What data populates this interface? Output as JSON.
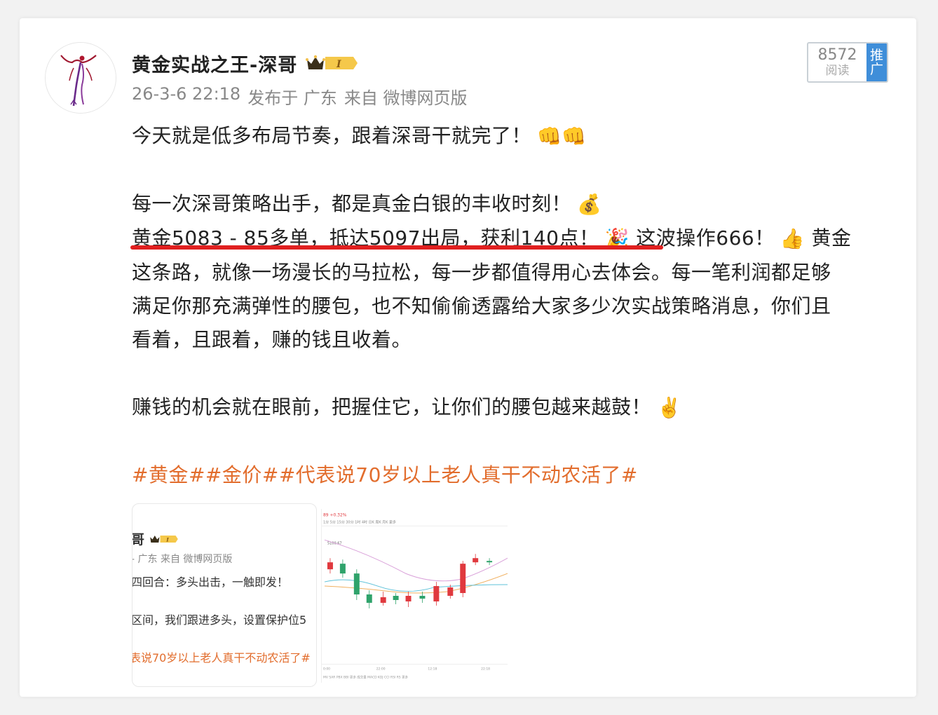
{
  "author": {
    "name": "黄金实战之王-深哥",
    "badge_level": "I"
  },
  "meta": {
    "time": "26-3-6 22:18",
    "location": "发布于 广东",
    "source": "来自 微博网页版"
  },
  "reads": {
    "count": "8572",
    "label": "阅读",
    "promo_label_1": "推",
    "promo_label_2": "广"
  },
  "post": {
    "line1": "今天就是低多布局节奏，跟着深哥干就完了！",
    "line1_emoji": "👊👊",
    "line2": "每一次深哥策略出手，都是真金白银的丰收时刻！",
    "line2_emoji": "💰",
    "line3a": "黄金5083 - 85多单，抵达5097出局，获利140点！",
    "line3_emoji1": "🎉",
    "line3b": "这波操作666！",
    "line3_emoji2": "👍",
    "line3c": "黄金",
    "line4": "这条路，就像一场漫长的马拉松，每一步都值得用心去体会。每一笔利润都足够",
    "line5": "满足你那充满弹性的腰包，也不知偷偷透露给大家多少次实战策略消息，你们且",
    "line6": "看着，且跟着，赚的钱且收着。",
    "line7": "赚钱的机会就在眼前，把握住它，让你们的腰包越来越鼓！",
    "line7_emoji": "✌️",
    "hashtags": "#黄金##金价##代表说70岁以上老人真干不动农活了#"
  },
  "thumbnail_1": {
    "name_fragment": "哥",
    "badge_level": "I",
    "meta_fragment": "- 广东  来自  微博网页版",
    "text1": "四回合：多头出击，一触即发！",
    "text2": "区间，我们跟进多头，设置保护位5",
    "hashtag_fragment": "表说70岁以上老人真干不动农活了#"
  },
  "thumbnail_2": {
    "header": "89  +0.32%",
    "price_label": "5100.67",
    "colors": {
      "up": "#e0393e",
      "down": "#2fa36b",
      "ma1": "#d9a0d9",
      "ma2": "#f0b060",
      "ma3": "#5fc2d9"
    }
  },
  "colors": {
    "hashtag": "#e26d2d",
    "underline": "#e02020",
    "promo_bg": "#3f8ed9"
  }
}
